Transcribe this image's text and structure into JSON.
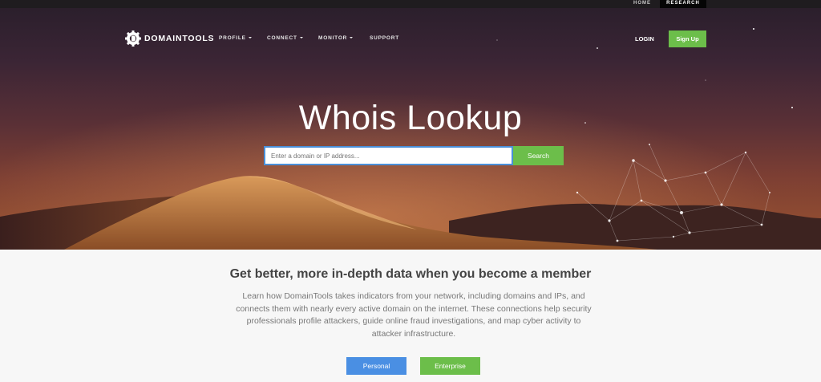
{
  "topbar": {
    "home": "HOME",
    "research": "RESEARCH"
  },
  "header": {
    "brand": "DOMAINTOOLS",
    "nav": [
      {
        "label": "PROFILE",
        "has_dropdown": true
      },
      {
        "label": "CONNECT",
        "has_dropdown": true
      },
      {
        "label": "MONITOR",
        "has_dropdown": true
      },
      {
        "label": "SUPPORT",
        "has_dropdown": false
      }
    ],
    "login": "LOGIN",
    "signup": "Sign Up"
  },
  "hero": {
    "title": "Whois Lookup",
    "search_placeholder": "Enter a domain or IP address...",
    "search_button": "Search"
  },
  "promo": {
    "title": "Get better, more in-depth data when you become a member",
    "body": "Learn how DomainTools takes indicators from your network, including domains and IPs, and connects them with nearly every active domain on the internet. These connections help security professionals profile attackers, guide online fraud investigations, and map cyber activity to attacker infrastructure.",
    "personal_button": "Personal",
    "enterprise_button": "Enterprise"
  },
  "colors": {
    "accent_green": "#6cbe4a",
    "accent_blue": "#4a8fe3",
    "search_border": "#4a90d9"
  },
  "icons": {
    "logo": "domaintools-gear-logo-icon",
    "caret": "caret-down-icon"
  }
}
